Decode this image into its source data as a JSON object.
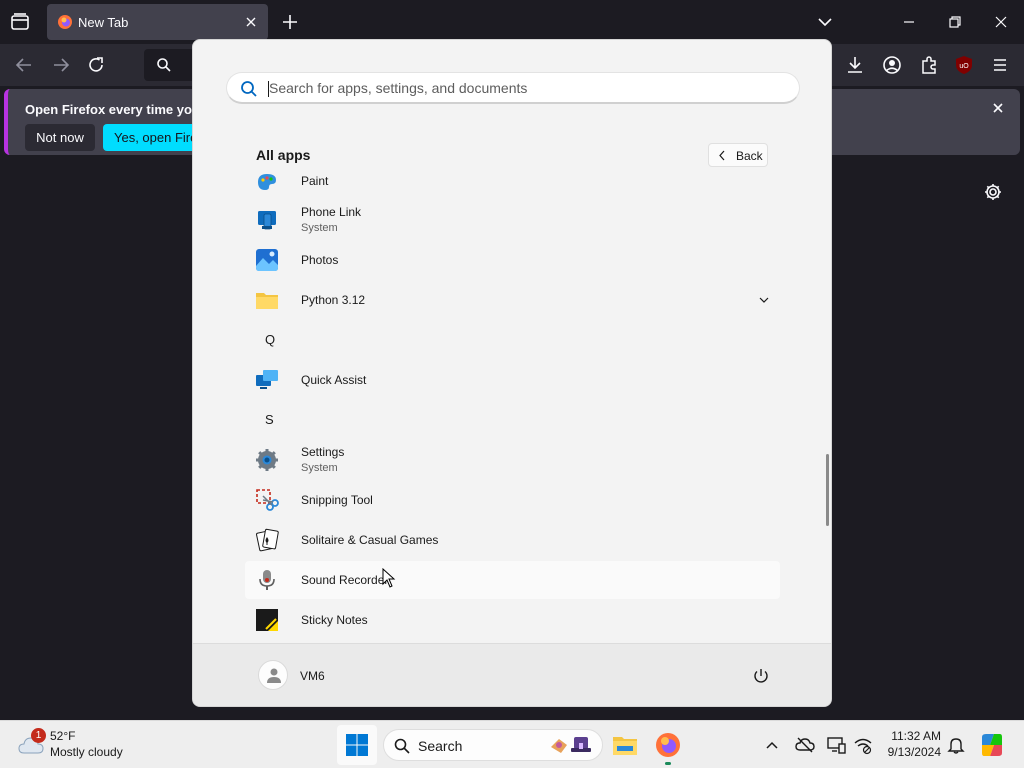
{
  "browser": {
    "tab": {
      "title": "New Tab"
    },
    "notification": {
      "text": "Open Firefox every time you re",
      "not_now": "Not now",
      "yes": "Yes, open Firefo"
    }
  },
  "start_menu": {
    "search": {
      "placeholder": "Search for apps, settings, and documents"
    },
    "all_apps_title": "All apps",
    "back_label": "Back",
    "apps": {
      "paint": {
        "name": "Paint"
      },
      "phone_link": {
        "name": "Phone Link",
        "sub": "System"
      },
      "photos": {
        "name": "Photos"
      },
      "python": {
        "name": "Python 3.12"
      },
      "letter_q": "Q",
      "quick_assist": {
        "name": "Quick Assist"
      },
      "letter_s": "S",
      "settings": {
        "name": "Settings",
        "sub": "System"
      },
      "snipping_tool": {
        "name": "Snipping Tool"
      },
      "solitaire": {
        "name": "Solitaire & Casual Games"
      },
      "sound_recorder": {
        "name": "Sound Recorder"
      },
      "sticky_notes": {
        "name": "Sticky Notes"
      }
    },
    "user_name": "VM6"
  },
  "taskbar": {
    "weather": {
      "badge": "1",
      "temp": "52°F",
      "desc": "Mostly cloudy"
    },
    "search_label": "Search",
    "clock": {
      "time": "11:32 AM",
      "date": "9/13/2024"
    }
  },
  "colors": {
    "firefox_dark": "#1c1b22",
    "toolbar": "#2b2a33",
    "accent_cyan": "#00ddff",
    "start_bg": "#f3f3f3",
    "windows_blue": "#0078d4"
  }
}
